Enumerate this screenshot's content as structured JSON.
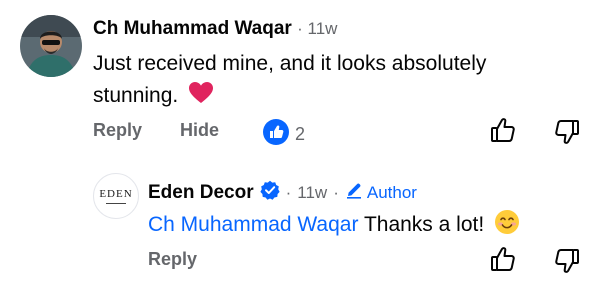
{
  "comment": {
    "author": "Ch Muhammad Waqar",
    "time": "11w",
    "text": "Just received mine, and it looks absolutely stunning.",
    "reaction": "heart-emoji",
    "actions": {
      "reply": "Reply",
      "hide": "Hide"
    },
    "like_count": "2"
  },
  "reply": {
    "avatar_text": "EDEN",
    "author": "Eden Decor",
    "verified": true,
    "time": "11w",
    "badge": "Author",
    "mention": "Ch Muhammad Waqar",
    "text": "Thanks a lot!",
    "reaction": "smiling-face-emoji",
    "actions": {
      "reply": "Reply"
    }
  },
  "colors": {
    "accent": "#0866ff",
    "secondary_text": "#65676b",
    "heart": "#e0245e"
  }
}
